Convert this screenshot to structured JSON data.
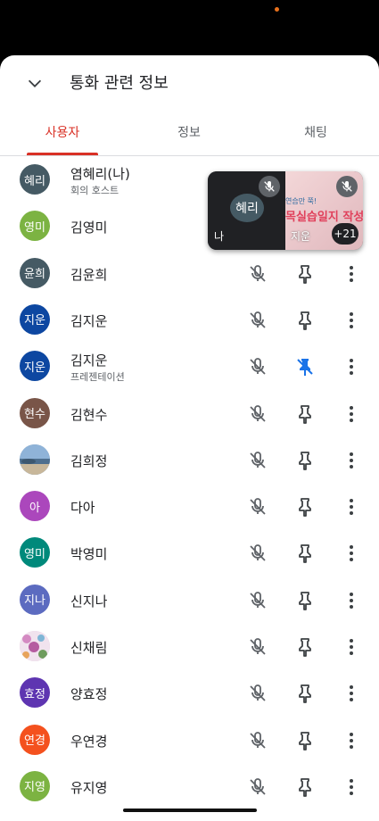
{
  "sheet": {
    "title": "통화 관련 정보",
    "tabs": [
      {
        "label": "사용자",
        "active": true
      },
      {
        "label": "정보",
        "active": false
      },
      {
        "label": "채팅",
        "active": false
      }
    ]
  },
  "pip": {
    "self_avatar": "혜리",
    "self_label": "나",
    "other_label": "지운",
    "presentation_line1": "연습만 쭉!",
    "presentation_line2": "목실습일지 작성",
    "more_count": "+21"
  },
  "participants": [
    {
      "avatar": "혜리",
      "name": "염혜리(나)",
      "sub": "회의 호스트",
      "color": "#455a64"
    },
    {
      "avatar": "영미",
      "name": "김영미",
      "sub": "",
      "color": "#7cb342"
    },
    {
      "avatar": "윤희",
      "name": "김윤희",
      "sub": "",
      "color": "#455a64"
    },
    {
      "avatar": "지운",
      "name": "김지운",
      "sub": "",
      "color": "#0d47a1"
    },
    {
      "avatar": "지운",
      "name": "김지운",
      "sub": "프레젠테이션",
      "color": "#0d47a1",
      "pinned": true
    },
    {
      "avatar": "현수",
      "name": "김현수",
      "sub": "",
      "color": "#795548"
    },
    {
      "avatar": "",
      "name": "김희정",
      "sub": "",
      "color": "#6a8fb0",
      "image": "landscape"
    },
    {
      "avatar": "아",
      "name": "다아",
      "sub": "",
      "color": "#ab47bc"
    },
    {
      "avatar": "영미",
      "name": "박영미",
      "sub": "",
      "color": "#00897b"
    },
    {
      "avatar": "지나",
      "name": "신지나",
      "sub": "",
      "color": "#5c6bc0"
    },
    {
      "avatar": "",
      "name": "신채림",
      "sub": "",
      "color": "#e0c0d8",
      "image": "floral"
    },
    {
      "avatar": "효정",
      "name": "양효정",
      "sub": "",
      "color": "#5e35b1"
    },
    {
      "avatar": "연경",
      "name": "우연경",
      "sub": "",
      "color": "#f4511e"
    },
    {
      "avatar": "지영",
      "name": "유지영",
      "sub": "",
      "color": "#7cb342"
    }
  ],
  "colors": {
    "accent": "#d93025",
    "pin_active": "#1a73e8",
    "icon": "#5f6368"
  }
}
